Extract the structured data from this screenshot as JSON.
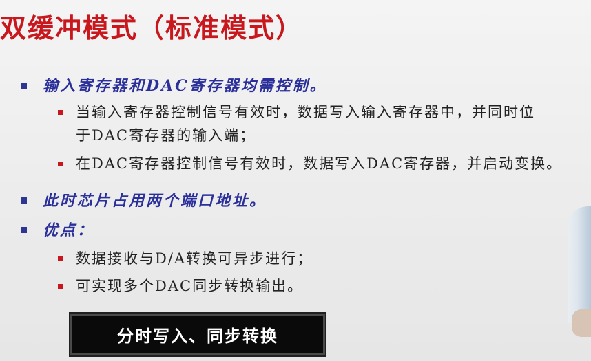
{
  "title": "双缓冲模式（标准模式）",
  "bullets": [
    {
      "text": "输入寄存器和DAC寄存器均需控制。",
      "sub": [
        [
          "当输入寄存器控制信号有效时，数据写入输入寄存器中，并同时位",
          "于DAC寄存器的输入端；"
        ],
        [
          "在DAC寄存器控制信号有效时，数据写入DAC寄存器，并启动变换。"
        ]
      ]
    },
    {
      "text": "此时芯片占用两个端口地址。",
      "sub": []
    },
    {
      "text": "优点：",
      "sub": [
        [
          "数据接收与D/A转换可异步进行；"
        ],
        [
          "可实现多个DAC同步转换输出。"
        ]
      ]
    }
  ],
  "banner": "分时写入、同步转换",
  "colors": {
    "title": "#c8171d",
    "level1": "#2a2f9a",
    "red_bullet": "#c7161d"
  }
}
